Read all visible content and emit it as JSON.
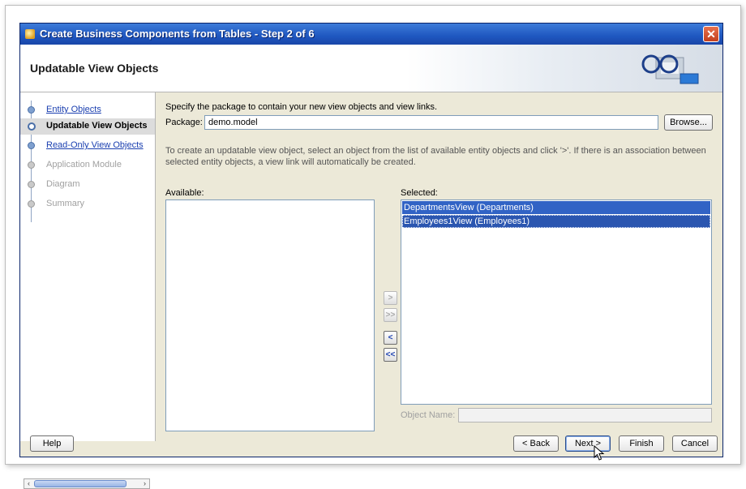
{
  "window": {
    "title": "Create Business Components from Tables - Step 2 of 6",
    "close_glyph": "✕"
  },
  "header": {
    "heading": "Updatable View Objects"
  },
  "nav": {
    "items": [
      {
        "label": "Entity Objects",
        "state": "done"
      },
      {
        "label": "Updatable View Objects",
        "state": "current"
      },
      {
        "label": "Read-Only View Objects",
        "state": "done"
      },
      {
        "label": "Application Module",
        "state": "future"
      },
      {
        "label": "Diagram",
        "state": "future"
      },
      {
        "label": "Summary",
        "state": "future"
      }
    ],
    "scroll_left": "‹",
    "scroll_right": "›"
  },
  "content": {
    "instruction": "Specify the package to contain your new view objects and view links.",
    "package_label": "Package:",
    "package_value": "demo.model",
    "browse_label": "Browse...",
    "description": "To create an updatable view object, select an object from the list of available entity objects and click '>'.  If there is an association between selected entity objects, a view link will automatically be created.",
    "available_label": "Available:",
    "selected_label": "Selected:",
    "selected_items": [
      "DepartmentsView (Departments)",
      "Employees1View (Employees1)"
    ],
    "shuttle": {
      "add": ">",
      "add_all": ">>",
      "remove": "<",
      "remove_all": "<<"
    },
    "object_name_label": "Object Name:",
    "object_name_value": ""
  },
  "buttons": {
    "help": "Help",
    "back": "< Back",
    "next": "Next >",
    "finish": "Finish",
    "cancel": "Cancel"
  }
}
